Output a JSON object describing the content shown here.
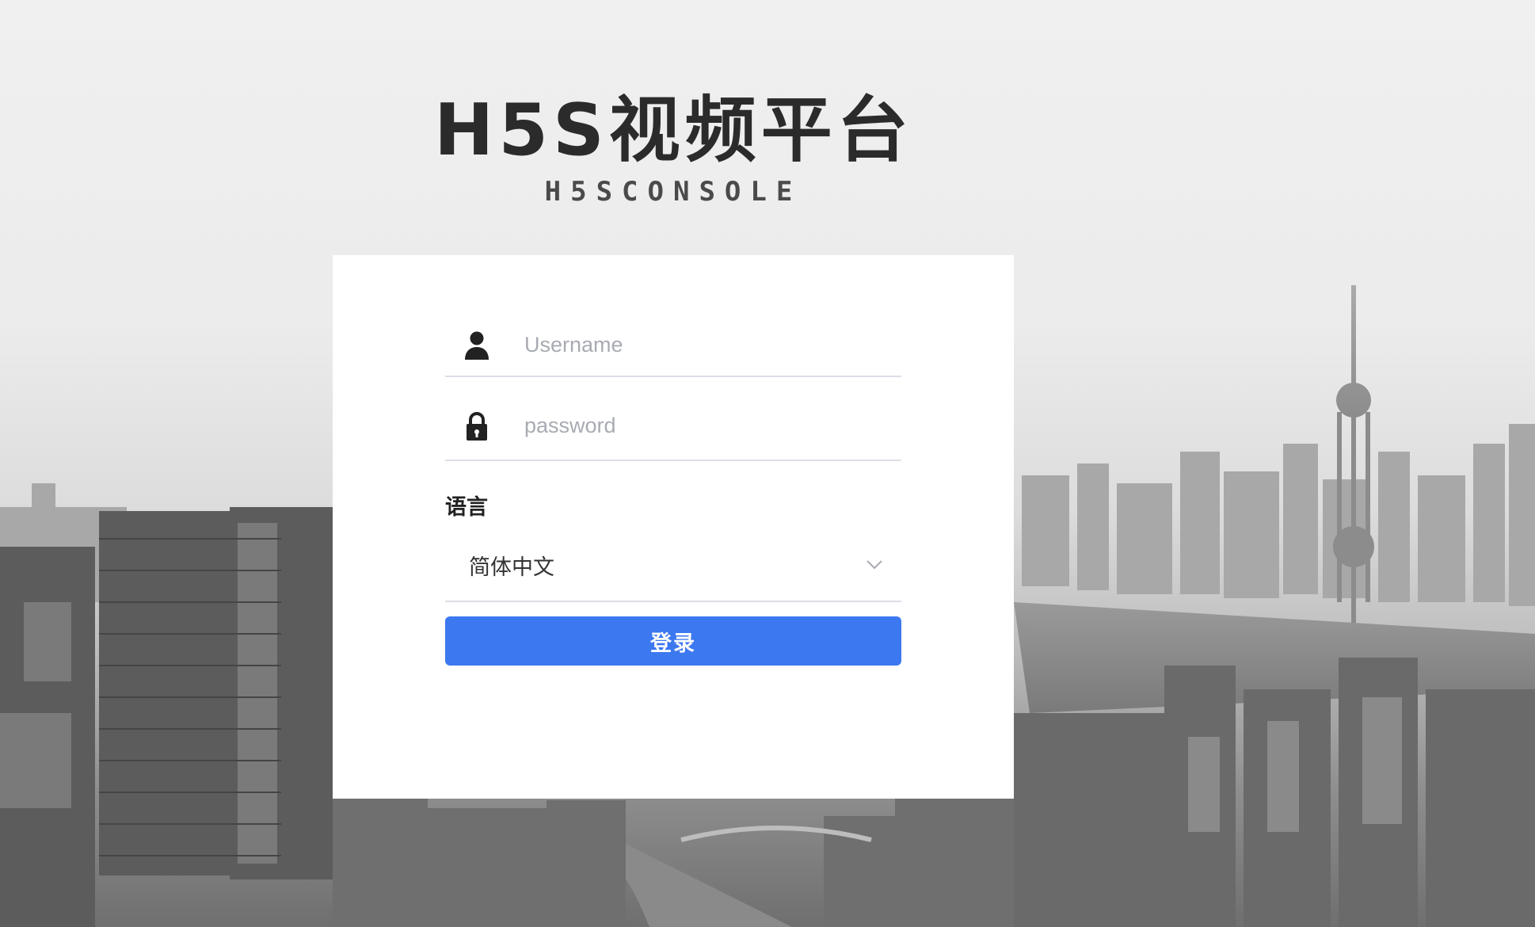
{
  "brand": {
    "title": "H5S视频平台",
    "subtitle": "H5SCONSOLE"
  },
  "login": {
    "username_placeholder": "Username",
    "password_placeholder": "password",
    "language_label": "语言",
    "language_value": "简体中文",
    "submit_label": "登录"
  },
  "colors": {
    "primary": "#3c78f0",
    "card": "#ffffff",
    "border": "#dcdfe6"
  },
  "icons": {
    "username": "user-icon",
    "password": "lock-icon",
    "select": "chevron-down-icon"
  }
}
